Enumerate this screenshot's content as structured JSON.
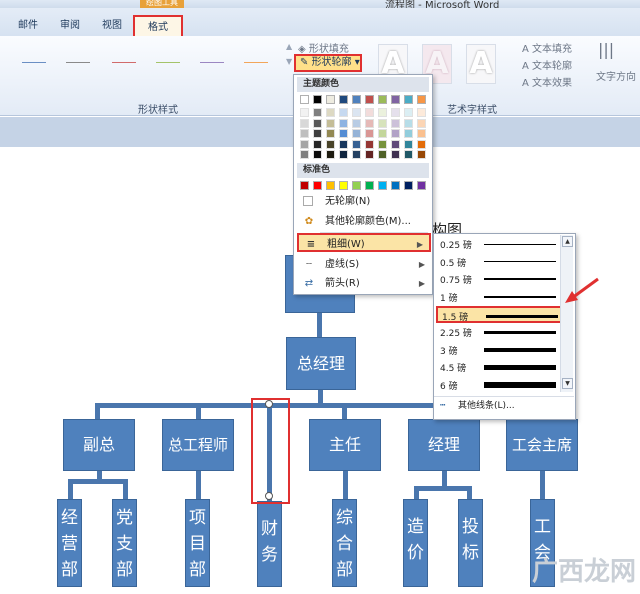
{
  "window": {
    "context_label": "绘图工具",
    "title": "流程图 - Microsoft Word"
  },
  "tabs": [
    "邮件",
    "审阅",
    "视图"
  ],
  "active_tab": "格式",
  "ribbon": {
    "shape_fill": "形状填充",
    "shape_outline": "形状轮廓",
    "shape_effects_group": "形状样式",
    "text_fill": "文本填充",
    "text_outline": "文本轮廓",
    "text_effects": "文本效果",
    "wordart_group": "艺术字样式",
    "text_direction": "文字方向",
    "wordart_letter": "A"
  },
  "outline_menu": {
    "theme_colors": "主题颜色",
    "standard_colors": "标准色",
    "no_outline": "无轮廓(N)",
    "more_colors": "其他轮廓颜色(M)...",
    "weight": "粗细(W)",
    "dashes": "虚线(S)",
    "arrows": "箭头(R)",
    "theme_top": [
      "#ffffff",
      "#000000",
      "#eeece1",
      "#1f497d",
      "#4f81bd",
      "#c0504d",
      "#9bbb59",
      "#8064a2",
      "#4bacc6",
      "#f79646"
    ],
    "theme_shades": [
      [
        "#f2f2f2",
        "#7f7f7f",
        "#ddd9c3",
        "#c6d9f0",
        "#dbe5f1",
        "#f2dcdb",
        "#ebf1dd",
        "#e5e0ec",
        "#dbeef3",
        "#fdeada"
      ],
      [
        "#d8d8d8",
        "#595959",
        "#c4bd97",
        "#8db3e2",
        "#b8cce4",
        "#e5b9b7",
        "#d7e3bc",
        "#ccc1d9",
        "#b7dde8",
        "#fbd5b5"
      ],
      [
        "#bfbfbf",
        "#3f3f3f",
        "#938953",
        "#548dd4",
        "#95b3d7",
        "#d99694",
        "#c3d69b",
        "#b2a2c7",
        "#92cddc",
        "#fac08f"
      ],
      [
        "#a5a5a5",
        "#262626",
        "#494429",
        "#17365d",
        "#366092",
        "#953734",
        "#76923c",
        "#5f497a",
        "#31859b",
        "#e36c09"
      ],
      [
        "#7f7f7f",
        "#0c0c0c",
        "#1d1b10",
        "#0f243e",
        "#244061",
        "#632423",
        "#4f6128",
        "#3f3151",
        "#205867",
        "#974806"
      ]
    ],
    "standard": [
      "#c00000",
      "#ff0000",
      "#ffc000",
      "#ffff00",
      "#92d050",
      "#00b050",
      "#00b0f0",
      "#0070c0",
      "#002060",
      "#7030a0"
    ]
  },
  "weight_menu": {
    "options": [
      "0.25 磅",
      "0.5 磅",
      "0.75 磅",
      "1 磅",
      "1.5 磅",
      "2.25 磅",
      "3 磅",
      "4.5 磅",
      "6 磅"
    ],
    "selected": "1.5 磅",
    "more": "其他线条(L)..."
  },
  "document": {
    "heading_partial": "构图",
    "ceo": "总经理",
    "level2": [
      "副总",
      "总工程师",
      "主任",
      "经理",
      "工会主席"
    ],
    "level3": [
      "经营部",
      "党支部",
      "项目部",
      "财务",
      "综合部",
      "造价",
      "投标",
      "工会"
    ]
  },
  "watermark": "广西龙网",
  "colors": {
    "box_fill": "#4f81bd",
    "highlight_red": "#e03030",
    "menu_hover": "#fbe4a6"
  }
}
